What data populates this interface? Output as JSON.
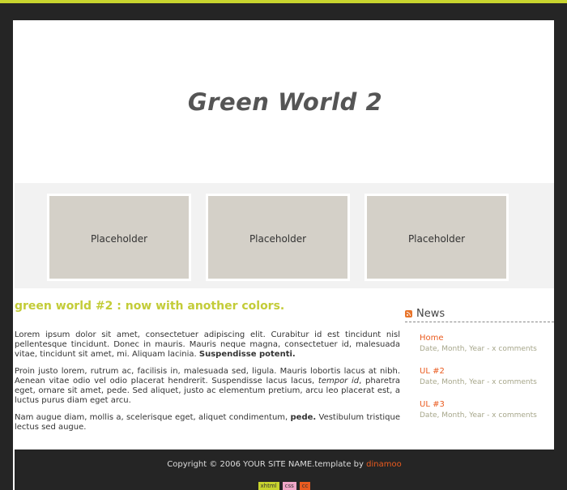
{
  "header": {
    "title": "Green World 2"
  },
  "gallery": {
    "items": [
      "Placeholder",
      "Placeholder",
      "Placeholder"
    ]
  },
  "content": {
    "heading": "green world #2 : now with another colors.",
    "paragraphs": [
      {
        "text": "Lorem ipsum dolor sit amet, consectetuer adipiscing elit. Curabitur id est tincidunt nisl pellentesque tincidunt. Donec in mauris. Mauris neque magna, consectetuer id, malesuada vitae, tincidunt sit amet, mi. Aliquam lacinia.",
        "bold": "Suspendisse potenti."
      },
      {
        "before": "Proin justo lorem, rutrum ac, facilisis in, malesuada sed, ligula. Mauris lobortis lacus at nibh. Aenean vitae odio vel odio placerat hendrerit. Suspendisse lacus lacus,",
        "italic": "tempor id",
        "after": ", pharetra eget, ornare sit amet, pede. Sed aliquet, justo ac elementum pretium, arcu leo placerat est, a luctus purus diam eget arcu."
      },
      {
        "before": "Nam augue diam, mollis a, scelerisque eget, aliquet condimentum,",
        "bold": "pede.",
        "after": "Vestibulum tristique lectus sed augue."
      }
    ]
  },
  "sidebar": {
    "title": "News",
    "items": [
      {
        "label": "Home",
        "meta": "Date, Month, Year - x comments"
      },
      {
        "label": "UL #2",
        "meta": "Date, Month, Year - x comments"
      },
      {
        "label": "UL #3",
        "meta": "Date, Month, Year - x comments"
      }
    ]
  },
  "footer": {
    "copyright": "Copyright © 2006 YOUR SITE NAME.template by",
    "author": "dinamoo",
    "badges": [
      {
        "label": "xhtml",
        "color": "#c8d42e"
      },
      {
        "label": "css",
        "color": "#f0a6c8"
      },
      {
        "label": "cc",
        "color": "#ea5b1f"
      }
    ]
  },
  "colors": {
    "accent": "#c8d42e",
    "link": "#ea5b1f",
    "background": "#252525"
  },
  "icons": {
    "news": "rss-icon"
  }
}
